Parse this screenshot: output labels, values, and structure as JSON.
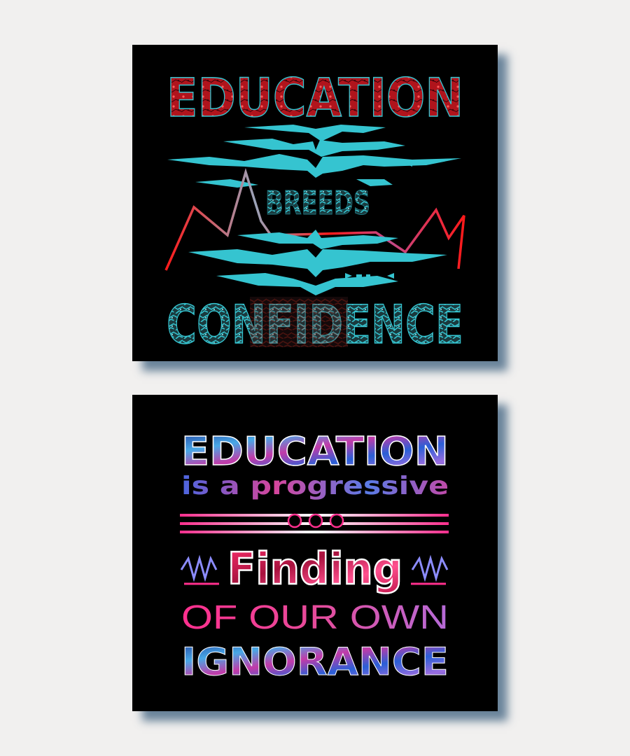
{
  "poster_top": {
    "line1": "EDUCATION",
    "line2": "BREEDS",
    "line3": "CONFIDENCE",
    "colors": {
      "red": "#b0141c",
      "teal": "#35c4d0",
      "bright_red": "#ff1a1a"
    }
  },
  "poster_bottom": {
    "line1": "EDUCATION",
    "line2": "is a progressive",
    "line3": "Finding",
    "line4": "OF OUR OWN",
    "line5": "IGNORANCE",
    "colors": {
      "blue": "#2d5bd8",
      "pink": "#ff2f8e",
      "purple": "#8c5bd8"
    }
  }
}
